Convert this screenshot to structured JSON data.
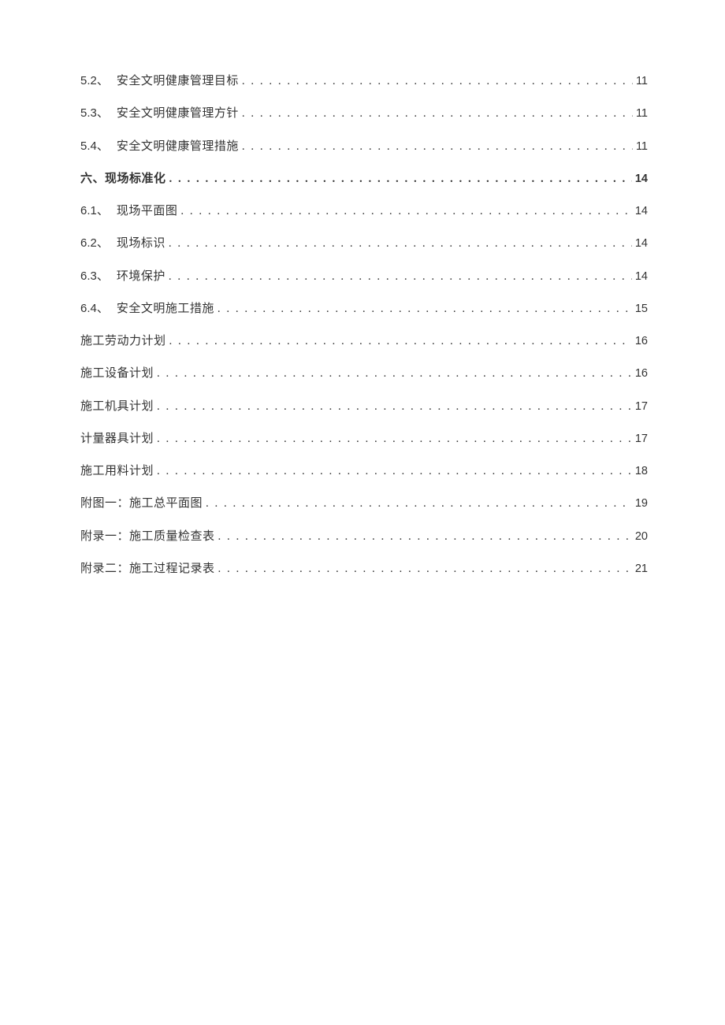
{
  "toc": [
    {
      "number": "5.2、",
      "title": "安全文明健康管理目标",
      "page": "11",
      "indented": true,
      "bold": false
    },
    {
      "number": "5.3、",
      "title": "安全文明健康管理方针",
      "page": "11",
      "indented": true,
      "bold": false
    },
    {
      "number": "5.4、",
      "title": "安全文明健康管理措施",
      "page": "11",
      "indented": true,
      "bold": false
    },
    {
      "number": "",
      "title": "六、现场标准化",
      "page": "14",
      "indented": false,
      "bold": true
    },
    {
      "number": "6.1、",
      "title": "现场平面图",
      "page": "14",
      "indented": true,
      "bold": false
    },
    {
      "number": "6.2、",
      "title": "现场标识",
      "page": "14",
      "indented": true,
      "bold": false
    },
    {
      "number": "6.3、",
      "title": "环境保护",
      "page": "14",
      "indented": true,
      "bold": false
    },
    {
      "number": "6.4、",
      "title": "安全文明施工措施",
      "page": "15",
      "indented": true,
      "bold": false
    },
    {
      "number": "",
      "title": "施工劳动力计划",
      "page": "16",
      "indented": false,
      "bold": false
    },
    {
      "number": "",
      "title": "施工设备计划",
      "page": "16",
      "indented": false,
      "bold": false
    },
    {
      "number": "",
      "title": "施工机具计划",
      "page": "17",
      "indented": false,
      "bold": false
    },
    {
      "number": "",
      "title": "计量器具计划",
      "page": "17",
      "indented": false,
      "bold": false
    },
    {
      "number": "",
      "title": "施工用料计划",
      "page": "18",
      "indented": false,
      "bold": false
    },
    {
      "number": "",
      "title": "附图一：施工总平面图",
      "page": "19",
      "indented": false,
      "bold": false
    },
    {
      "number": "",
      "title": "附录一：施工质量检查表",
      "page": "20",
      "indented": false,
      "bold": false
    },
    {
      "number": "",
      "title": "附录二：施工过程记录表",
      "page": "21",
      "indented": false,
      "bold": false
    }
  ]
}
